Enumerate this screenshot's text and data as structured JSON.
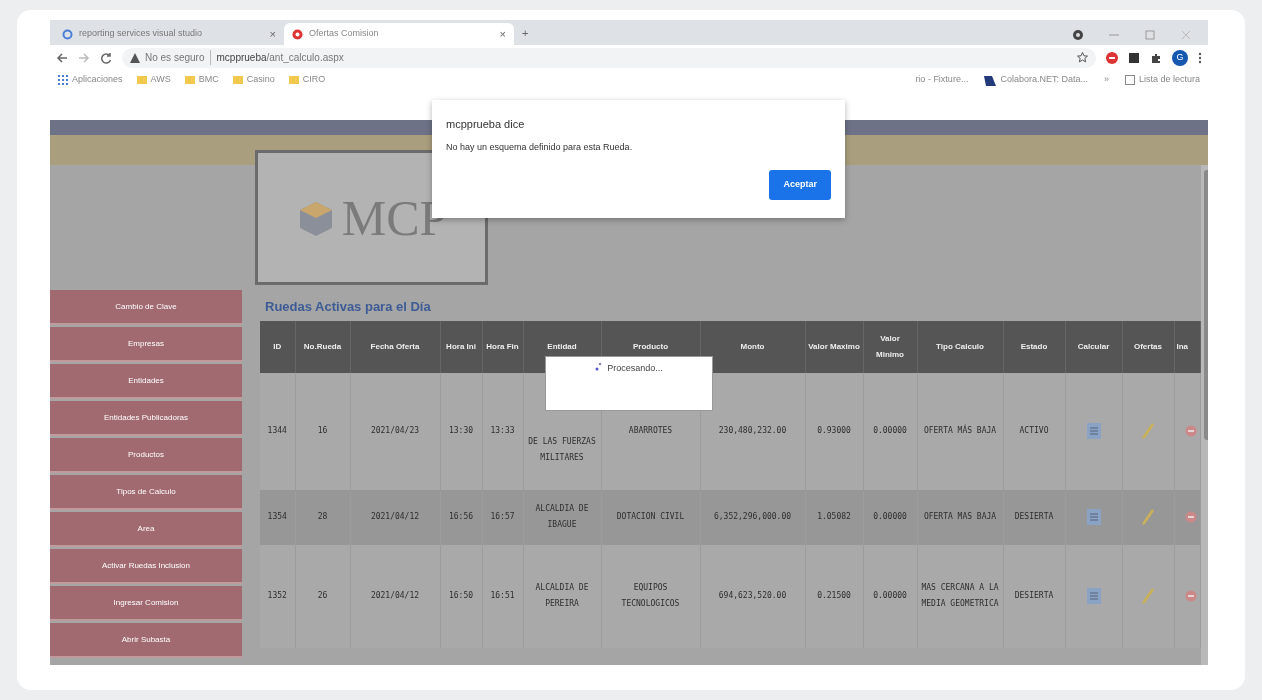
{
  "browser": {
    "tabs": [
      {
        "title": "reporting services visual studio",
        "kind": "google",
        "selected": false
      },
      {
        "title": "Ofertas Comision",
        "kind": "site",
        "selected": true
      }
    ],
    "new_tab": "+",
    "close": "×",
    "security": "No es seguro",
    "url_host": "mcpprueba",
    "url_path": "/ant_calculo.aspx",
    "avatar": "G",
    "bookmarks": [
      {
        "label": "Aplicaciones",
        "kind": "apps"
      },
      {
        "label": "AWS",
        "kind": "folder"
      },
      {
        "label": "BMC",
        "kind": "folder"
      },
      {
        "label": "Casino",
        "kind": "folder"
      },
      {
        "label": "CIRO",
        "kind": "folder"
      }
    ],
    "bookmarks_right": [
      {
        "label": "rio - Fixture...",
        "kind": "plain"
      },
      {
        "label": "Colabora.NET: Data...",
        "kind": "site"
      }
    ],
    "overflow": "»",
    "reading_list": "Lista de lectura"
  },
  "alert": {
    "title": "mcpprueba dice",
    "message": "No hay un esquema definido para esta Rueda.",
    "button": "Aceptar"
  },
  "processing": "Procesando...",
  "logo": {
    "text": "MCP"
  },
  "sidebar": {
    "items": [
      "Cambio de Clave",
      "Empresas",
      "Entidades",
      "Entidades Publicadoras",
      "Productos",
      "Tipos de Calculo",
      "Area",
      "Activar Ruedas Inclusion",
      "Ingresar Comision",
      "Abrir Subasta"
    ]
  },
  "heading": "Ruedas Activas para el Día",
  "table": {
    "columns": [
      "ID",
      "No.Rueda",
      "Fecha Oferta",
      "Hora Ini",
      "Hora Fin",
      "Entidad",
      "Producto",
      "Monto",
      "Valor Maximo",
      "Valor Minimo",
      "Tipo Calculo",
      "Estado",
      "Calcular",
      "Ofertas",
      "Ina"
    ],
    "rows": [
      {
        "cells": [
          "1344",
          "16",
          "2021/04/23",
          "13:30",
          "13:33",
          "DE LAS FUERZAS MILITARES",
          "ABARROTES",
          "230,480,232.00",
          "0.93000",
          "0.00000",
          "OFERTA MÁS BAJA",
          "ACTIVO"
        ]
      },
      {
        "cells": [
          "1354",
          "28",
          "2021/04/12",
          "16:56",
          "16:57",
          "ALCALDIA DE IBAGUE",
          "DOTACION CIVIL",
          "6,352,296,000.00",
          "1.05082",
          "0.00000",
          "OFERTA MAS BAJA",
          "DESIERTA"
        ]
      },
      {
        "cells": [
          "1352",
          "26",
          "2021/04/12",
          "16:50",
          "16:51",
          "ALCALDIA DE PEREIRA",
          "EQUIPOS TECNOLOGICOS",
          "694,623,520.00",
          "0.21500",
          "0.00000",
          "MAS CERCANA A LA MEDIA GEOMETRICA",
          "DESIERTA"
        ]
      }
    ]
  }
}
